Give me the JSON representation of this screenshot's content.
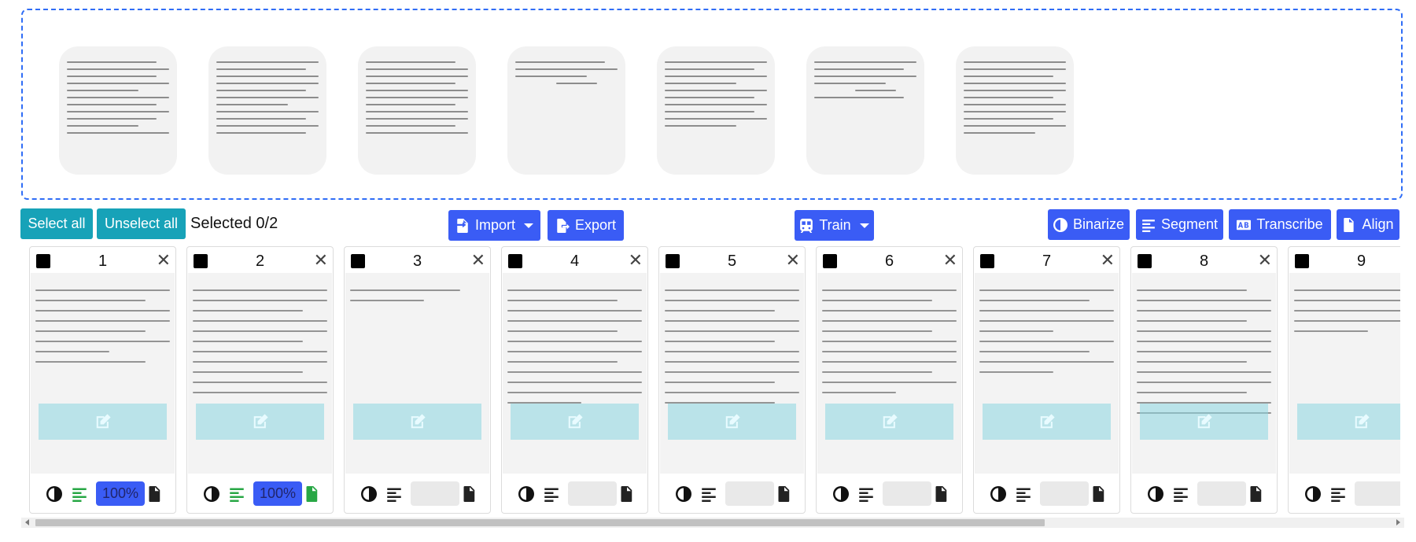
{
  "toolbar": {
    "select_all": "Select all",
    "unselect_all": "Unselect all",
    "selected_count": "Selected 0/2",
    "import": "Import",
    "export": "Export",
    "train": "Train",
    "binarize": "Binarize",
    "segment": "Segment",
    "transcribe": "Transcribe",
    "align": "Align"
  },
  "colors": {
    "primary": "#3a5cf5",
    "teal": "#17a2b8",
    "done_green": "#28a745",
    "overlay": "#8ad6e0"
  },
  "dropzone": {
    "preview_count": 7
  },
  "cards": [
    {
      "number": "1",
      "percent": "100%",
      "segmented": true,
      "transcribed": false
    },
    {
      "number": "2",
      "percent": "100%",
      "segmented": true,
      "transcribed": true
    },
    {
      "number": "3",
      "percent": "",
      "segmented": false,
      "transcribed": false
    },
    {
      "number": "4",
      "percent": "",
      "segmented": false,
      "transcribed": false
    },
    {
      "number": "5",
      "percent": "",
      "segmented": false,
      "transcribed": false
    },
    {
      "number": "6",
      "percent": "",
      "segmented": false,
      "transcribed": false
    },
    {
      "number": "7",
      "percent": "",
      "segmented": false,
      "transcribed": false
    },
    {
      "number": "8",
      "percent": "",
      "segmented": false,
      "transcribed": false
    },
    {
      "number": "9",
      "percent": "",
      "segmented": false,
      "transcribed": false
    }
  ],
  "icons": {
    "binarize": "half-circle-icon",
    "segment": "align-left-icon",
    "transcribe": "ab-icon",
    "align": "file-icon",
    "import": "file-import-icon",
    "export": "file-export-icon",
    "train": "train-icon",
    "edit": "edit-icon",
    "close": "close-icon"
  }
}
